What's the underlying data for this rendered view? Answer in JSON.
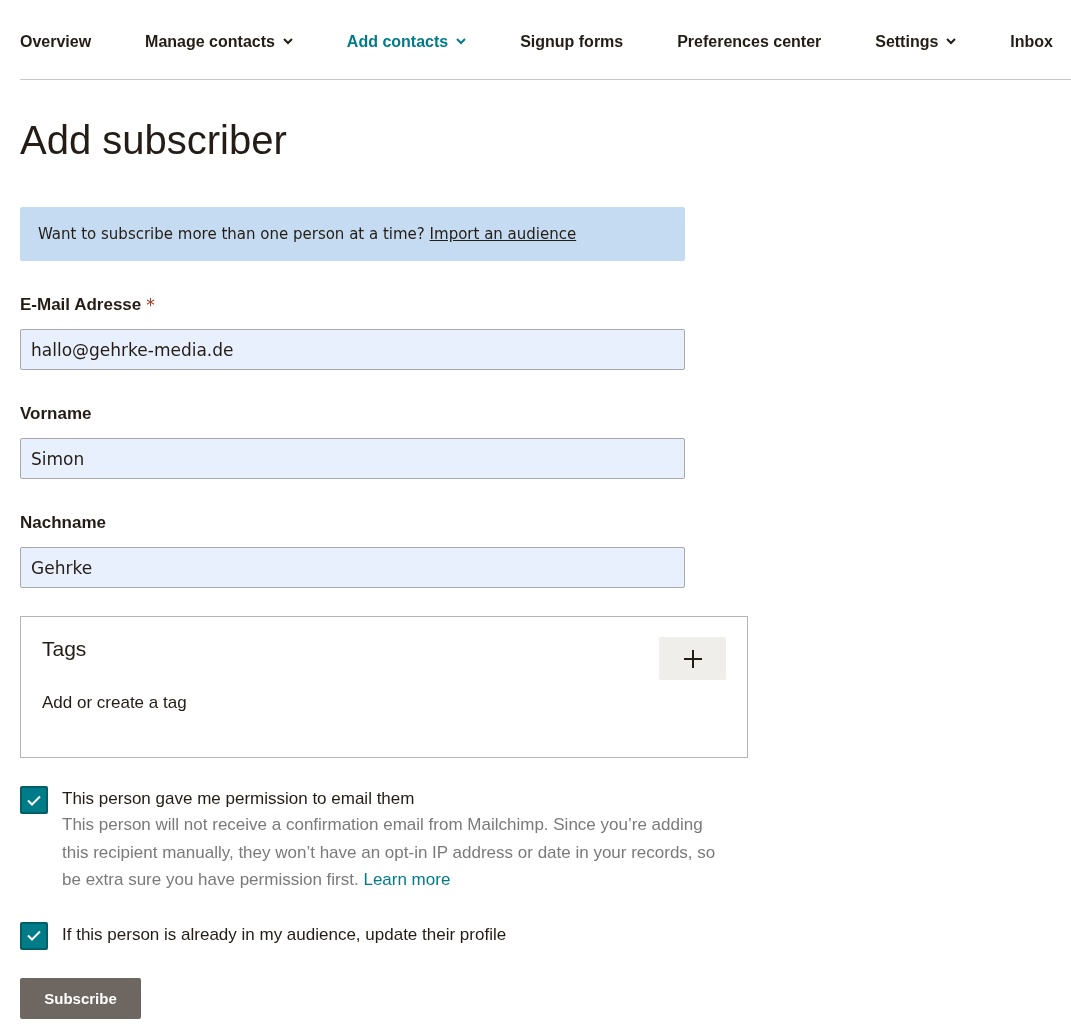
{
  "nav": [
    {
      "label": "Overview",
      "dropdown": false,
      "selected": false
    },
    {
      "label": "Manage contacts",
      "dropdown": true,
      "selected": false
    },
    {
      "label": "Add contacts",
      "dropdown": true,
      "selected": true
    },
    {
      "label": "Signup forms",
      "dropdown": false,
      "selected": false
    },
    {
      "label": "Preferences center",
      "dropdown": false,
      "selected": false
    },
    {
      "label": "Settings",
      "dropdown": true,
      "selected": false
    },
    {
      "label": "Inbox",
      "dropdown": false,
      "selected": false
    }
  ],
  "title": "Add subscriber",
  "banner": {
    "text": "Want to subscribe more than one person at a time?",
    "link": "Import an audience"
  },
  "fields": [
    {
      "label": "E-Mail Adresse",
      "required_mark": "*",
      "value": "hallo@gehrke-media.de"
    },
    {
      "label": "Vorname",
      "value": "Simon"
    },
    {
      "label": "Nachname",
      "value": "Gehrke"
    }
  ],
  "tags": {
    "title": "Tags",
    "placeholder": "Add or create a tag"
  },
  "checkboxes": [
    {
      "label": "This person gave me permission to email them",
      "checked": true,
      "description": "This person will not receive a confirmation email from Mailchimp. Since you’re adding this recipient manually, they won’t have an opt-in IP address or date in your records, so be extra sure you have permission first.",
      "link": "Learn more"
    },
    {
      "label": "If this person is already in my audience, update their profile",
      "checked": true
    }
  ],
  "submit": "Subscribe"
}
